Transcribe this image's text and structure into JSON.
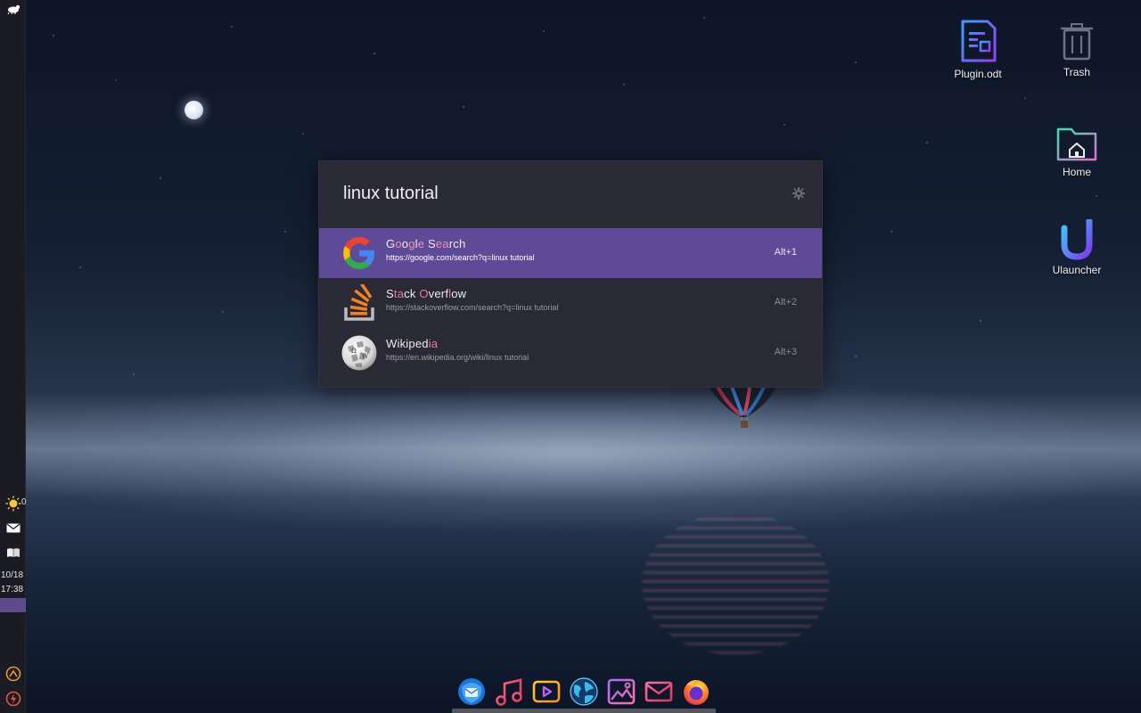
{
  "desktop": {
    "icons": [
      {
        "label": "Plugin.odt",
        "icon": "document-icon"
      },
      {
        "label": "Trash",
        "icon": "trash-icon"
      },
      {
        "label": "Home",
        "icon": "home-folder-icon"
      },
      {
        "label": "Ulauncher",
        "icon": "ulauncher-icon"
      }
    ]
  },
  "panel": {
    "weather_value": "0",
    "date": "10/18",
    "time": "17:38"
  },
  "launcher": {
    "query": "linux tutorial",
    "results": [
      {
        "title_parts": [
          [
            "G",
            0
          ],
          [
            "o",
            1
          ],
          [
            "o",
            0
          ],
          [
            "g",
            1
          ],
          [
            "l",
            0
          ],
          [
            "e",
            1
          ],
          [
            " ",
            0
          ],
          [
            "S",
            0
          ],
          [
            "e",
            1
          ],
          [
            "a",
            1
          ],
          [
            "r",
            0
          ],
          [
            "c",
            0
          ],
          [
            "h",
            0
          ]
        ],
        "title": "Google Search",
        "url": "https://google.com/search?q=linux tutorial",
        "shortcut": "Alt+1",
        "selected": true,
        "icon": "google-icon"
      },
      {
        "title_parts": [
          [
            "S",
            0
          ],
          [
            "t",
            1
          ],
          [
            "a",
            1
          ],
          [
            "c",
            0
          ],
          [
            "k",
            0
          ],
          [
            " ",
            0
          ],
          [
            "O",
            1
          ],
          [
            "v",
            0
          ],
          [
            "e",
            0
          ],
          [
            "r",
            0
          ],
          [
            "f",
            0
          ],
          [
            "l",
            1
          ],
          [
            "o",
            0
          ],
          [
            "w",
            0
          ]
        ],
        "title": "Stack Overflow",
        "url": "https://stackoverflow.com/search?q=linux tutorial",
        "shortcut": "Alt+2",
        "selected": false,
        "icon": "stackoverflow-icon"
      },
      {
        "title_parts": [
          [
            "W",
            0
          ],
          [
            "i",
            0
          ],
          [
            "k",
            0
          ],
          [
            "i",
            0
          ],
          [
            "p",
            0
          ],
          [
            "e",
            0
          ],
          [
            "d",
            0
          ],
          [
            "i",
            1
          ],
          [
            "a",
            1
          ]
        ],
        "title": "Wikipedia",
        "url": "https://en.wikipedia.org/wiki/linux tutorial",
        "shortcut": "Alt+3",
        "selected": false,
        "icon": "wikipedia-icon"
      }
    ]
  },
  "dock": {
    "items": [
      "thunderbird-icon",
      "music-icon",
      "video-icon",
      "web-browser-globe-icon",
      "image-viewer-icon",
      "mail-icon",
      "firefox-icon"
    ]
  },
  "colors": {
    "accent": "#5e4b97",
    "highlight_text": "#e37b9e"
  }
}
